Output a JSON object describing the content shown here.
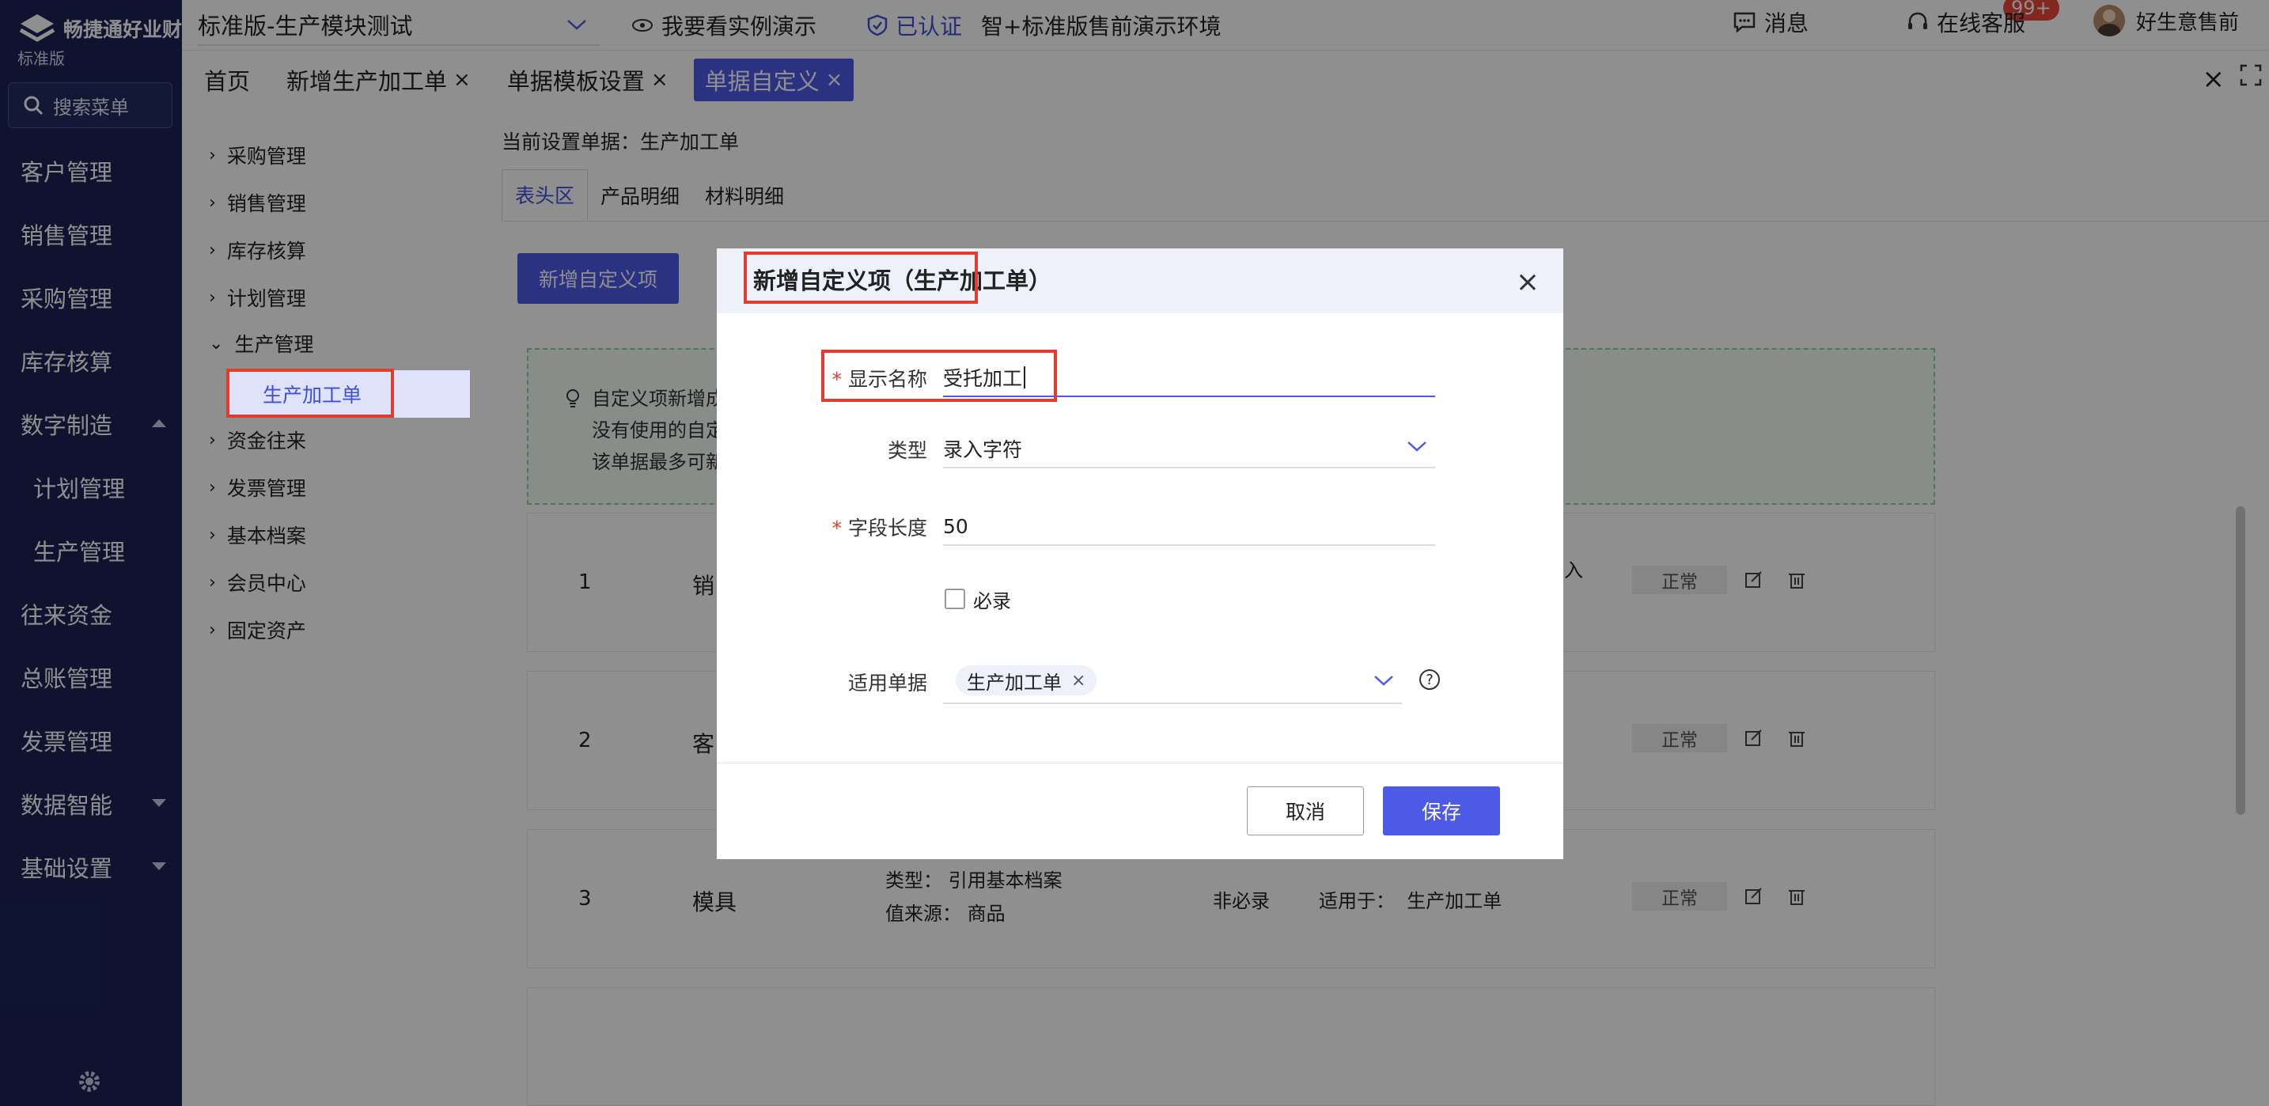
{
  "sidebar": {
    "brand": "畅捷通好业财",
    "edition": "标准版",
    "search_label": "搜索菜单",
    "items": [
      {
        "label": "客户管理"
      },
      {
        "label": "销售管理"
      },
      {
        "label": "采购管理"
      },
      {
        "label": "库存核算"
      },
      {
        "label": "数字制造"
      },
      {
        "label": "计划管理"
      },
      {
        "label": "生产管理"
      },
      {
        "label": "往来资金"
      },
      {
        "label": "总账管理"
      },
      {
        "label": "发票管理"
      },
      {
        "label": "数据智能"
      },
      {
        "label": "基础设置"
      }
    ]
  },
  "topbar": {
    "org": "标准版-生产模块测试",
    "demo": "我要看实例演示",
    "certified": "已认证",
    "env": "智+标准版售前演示环境",
    "messages": "消息",
    "badge": "99+",
    "service": "在线客服",
    "user": "好生意售前"
  },
  "tabs": [
    {
      "label": "首页"
    },
    {
      "label": "新增生产加工单"
    },
    {
      "label": "单据模板设置"
    },
    {
      "label": "单据自定义"
    }
  ],
  "subnav": {
    "items": [
      {
        "label": "采购管理",
        "chev": "›"
      },
      {
        "label": "销售管理",
        "chev": "›"
      },
      {
        "label": "库存核算",
        "chev": "›"
      },
      {
        "label": "计划管理",
        "chev": "›"
      },
      {
        "label": "生产管理",
        "chev": "⌄"
      },
      {
        "label": "资金往来",
        "chev": "›"
      },
      {
        "label": "发票管理",
        "chev": "›"
      },
      {
        "label": "基本档案",
        "chev": "›"
      },
      {
        "label": "会员中心",
        "chev": "›"
      },
      {
        "label": "固定资产",
        "chev": "›"
      }
    ],
    "active": "生产加工单"
  },
  "content": {
    "current_doc": "当前设置单据：生产加工单",
    "tabs": [
      "表头区",
      "产品明细",
      "材料明细"
    ],
    "add_button": "新增自定义项",
    "tip_lines": [
      "自定义项新增成",
      "没有使用的自定",
      "该单据最多可新"
    ],
    "rows": [
      {
        "num": "1",
        "name": "销",
        "meta1": "",
        "meta2": "",
        "req": "",
        "apply_label": "",
        "apply_value": "",
        "extra": "为录入",
        "status": "正常"
      },
      {
        "num": "2",
        "name": "客",
        "meta1": "",
        "meta2": "",
        "req": "",
        "apply_label": "",
        "apply_value": "",
        "extra": "",
        "status": "正常"
      },
      {
        "num": "3",
        "name": "模具",
        "meta1": "类型： 引用基本档案",
        "meta2": "值来源： 商品",
        "req": "非必录",
        "apply_label": "适用于：",
        "apply_value": "生产加工单",
        "extra": "",
        "status": "正常"
      }
    ]
  },
  "modal": {
    "title": "新增自定义项（生产加工单）",
    "display_name_label": "显示名称",
    "display_name_value": "受托加工",
    "type_label": "类型",
    "type_value": "录入字符",
    "length_label": "字段长度",
    "length_value": "50",
    "required_label": "必录",
    "apply_label": "适用单据",
    "apply_chip": "生产加工单",
    "cancel": "取消",
    "save": "保存"
  },
  "colors": {
    "sidebar": "#1b2357",
    "primary": "#4c5ae6",
    "highlight": "#e43b2c"
  }
}
